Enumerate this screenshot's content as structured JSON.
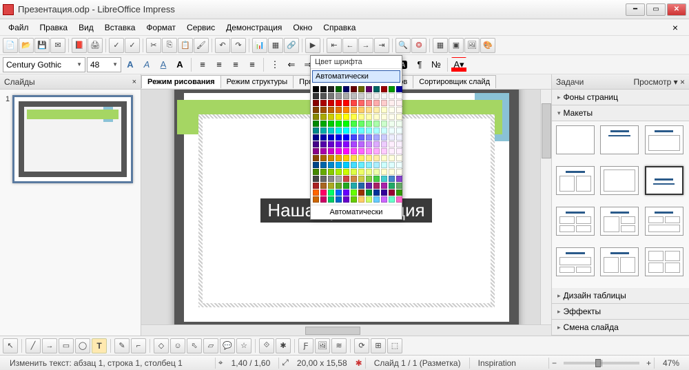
{
  "window": {
    "title": "Презентация.odp - LibreOffice Impress"
  },
  "menu": {
    "items": [
      "Файл",
      "Правка",
      "Вид",
      "Вставка",
      "Формат",
      "Сервис",
      "Демонстрация",
      "Окно",
      "Справка"
    ]
  },
  "font": {
    "name": "Century Gothic",
    "size": "48"
  },
  "color_popup": {
    "title": "Цвет шрифта",
    "auto": "Автоматически",
    "bottom": "Автоматически"
  },
  "view_tabs": [
    "Режим рисования",
    "Режим структуры",
    "Примечания",
    "Режим тезисов",
    "Сортировщик слайд"
  ],
  "slides_panel": {
    "title": "Слайды",
    "num": "1"
  },
  "tasks_panel": {
    "title": "Задачи",
    "view": "Просмотр",
    "sections": [
      "Фоны страниц",
      "Макеты",
      "Дизайн таблицы",
      "Эффекты",
      "Смена слайда"
    ]
  },
  "slide": {
    "title_text": "Наша презентация"
  },
  "status": {
    "edit": "Изменить текст: абзац 1, строка 1, столбец 1",
    "ratio": "1,40 / 1,60",
    "size": "20,00 x 15,58",
    "slide": "Слайд 1 / 1 (Разметка)",
    "template": "Inspiration",
    "zoom": "47%"
  },
  "chart_data": null
}
